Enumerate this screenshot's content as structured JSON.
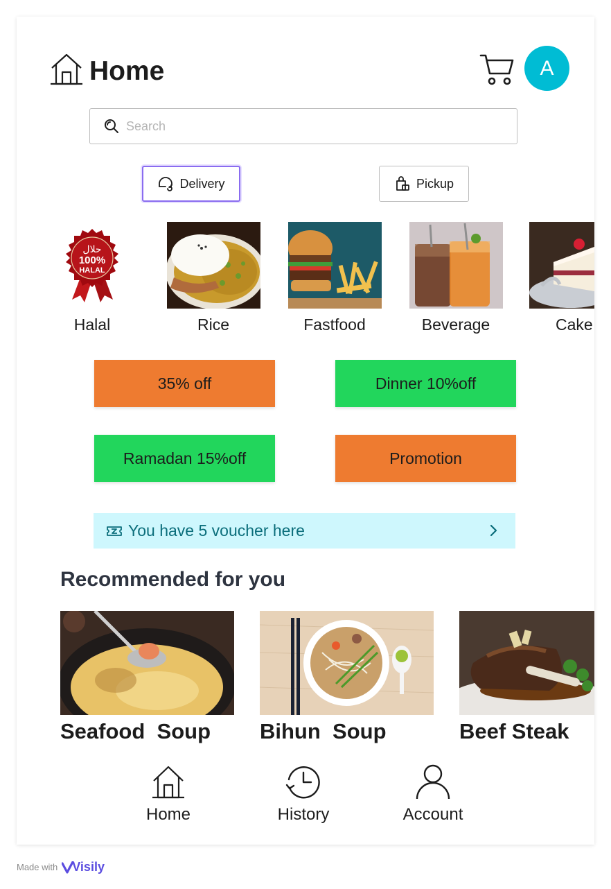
{
  "header": {
    "title": "Home",
    "avatar_initial": "A",
    "cart_icon": "cart-icon",
    "home_icon": "home-icon"
  },
  "search": {
    "placeholder": "Search",
    "value": ""
  },
  "modes": [
    {
      "label": "Delivery",
      "icon": "delivery-icon",
      "selected": true
    },
    {
      "label": "Pickup",
      "icon": "pickup-bag-icon",
      "selected": false
    }
  ],
  "categories": [
    {
      "label": "Halal"
    },
    {
      "label": "Rice"
    },
    {
      "label": "Fastfood"
    },
    {
      "label": "Beverage"
    },
    {
      "label": "Cake"
    }
  ],
  "halal_badge": {
    "arabic": "حلال",
    "percent": "100%",
    "word": "HALAL"
  },
  "promos": [
    {
      "label": "35% off",
      "color": "#ee7b30"
    },
    {
      "label": "Dinner 10%off",
      "color": "#22d65c"
    },
    {
      "label": "Ramadan 15%off",
      "color": "#22d65c"
    },
    {
      "label": "Promotion",
      "color": "#ee7b30"
    }
  ],
  "voucher": {
    "text": "You have 5 voucher here",
    "icon": "ticket-icon",
    "bg": "#cef7fd",
    "color": "#0b6e7b"
  },
  "recommended": {
    "title": "Recommended for you",
    "items": [
      {
        "name": "Seafood  Soup"
      },
      {
        "name": "Bihun  Soup"
      },
      {
        "name": "Beef Steak"
      }
    ]
  },
  "nav": [
    {
      "label": "Home",
      "icon": "home-icon"
    },
    {
      "label": "History",
      "icon": "history-icon"
    },
    {
      "label": "Account",
      "icon": "account-icon"
    }
  ],
  "footer": {
    "made_with": "Made with",
    "brand": "Visily"
  },
  "colors": {
    "accent": "#00bcd4",
    "selected_border": "#8a6cf0"
  }
}
